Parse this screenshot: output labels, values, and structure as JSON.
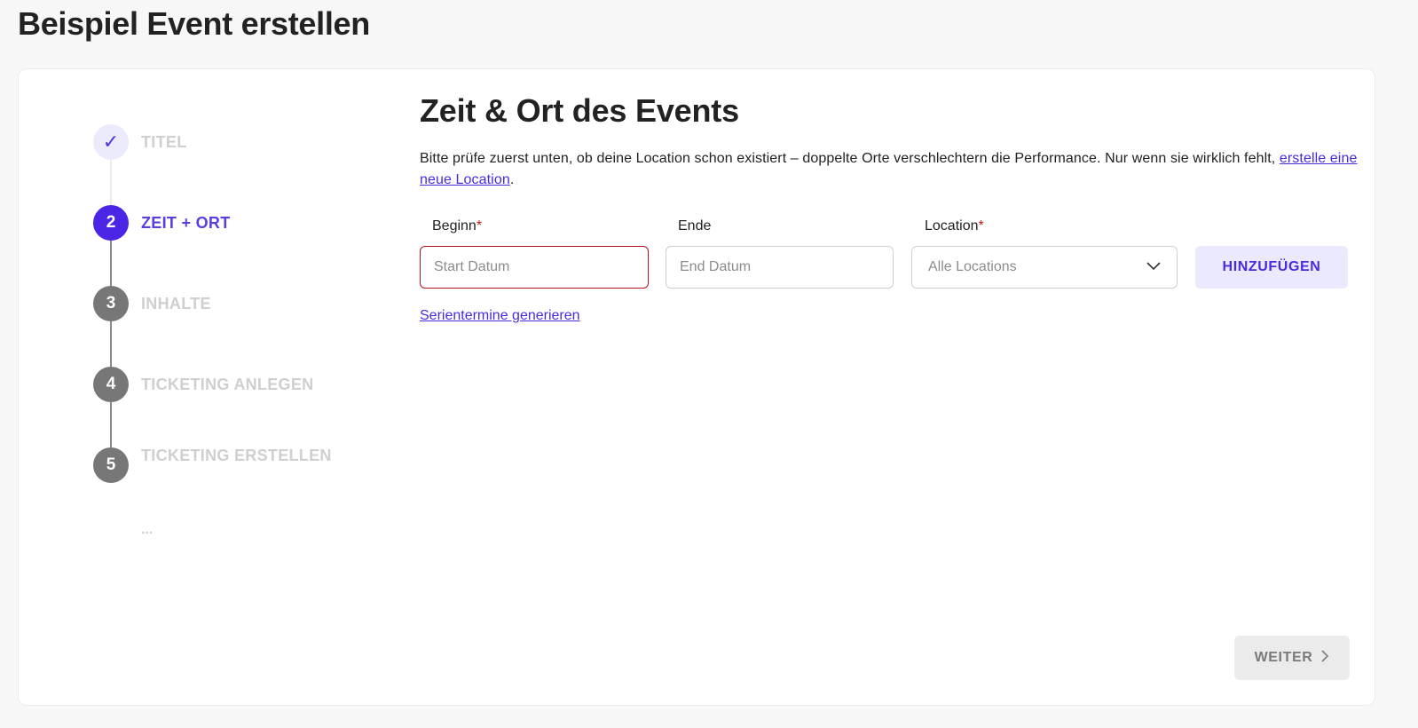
{
  "page": {
    "title": "Beispiel Event erstellen"
  },
  "stepper": {
    "steps": [
      {
        "number": "✓",
        "label": "TITEL",
        "state": "done"
      },
      {
        "number": "2",
        "label": "ZEIT + ORT",
        "state": "active"
      },
      {
        "number": "3",
        "label": "INHALTE",
        "state": "upcoming"
      },
      {
        "number": "4",
        "label": "TICKETING ANLEGEN",
        "state": "upcoming"
      },
      {
        "number": "5",
        "label": "TICKETING ERSTELLEN",
        "state": "upcoming",
        "ellipsis": "..."
      }
    ]
  },
  "main": {
    "title": "Zeit & Ort des Events",
    "intro": "Bitte prüfe zuerst unten, ob deine Location schon existiert – doppelte Orte verschlechtern die Performance. Nur wenn sie wirklich fehlt,",
    "intro_link": "erstelle eine neue Location",
    "intro_end": ".",
    "fields": {
      "begin": {
        "label": "Beginn",
        "required_mark": "*",
        "placeholder": "Start Datum",
        "value": ""
      },
      "end": {
        "label": "Ende",
        "placeholder": "End Datum",
        "value": ""
      },
      "location": {
        "label": "Location",
        "required_mark": "*",
        "selected": "Alle Locations"
      }
    },
    "add_button": "HINZUFÜGEN",
    "series_link": "Serientermine generieren",
    "next_button": "WEITER"
  },
  "colors": {
    "accent": "#4a25e6",
    "accent_light": "#ebe9fd",
    "error_border": "#b4141e",
    "required": "#c41818"
  }
}
